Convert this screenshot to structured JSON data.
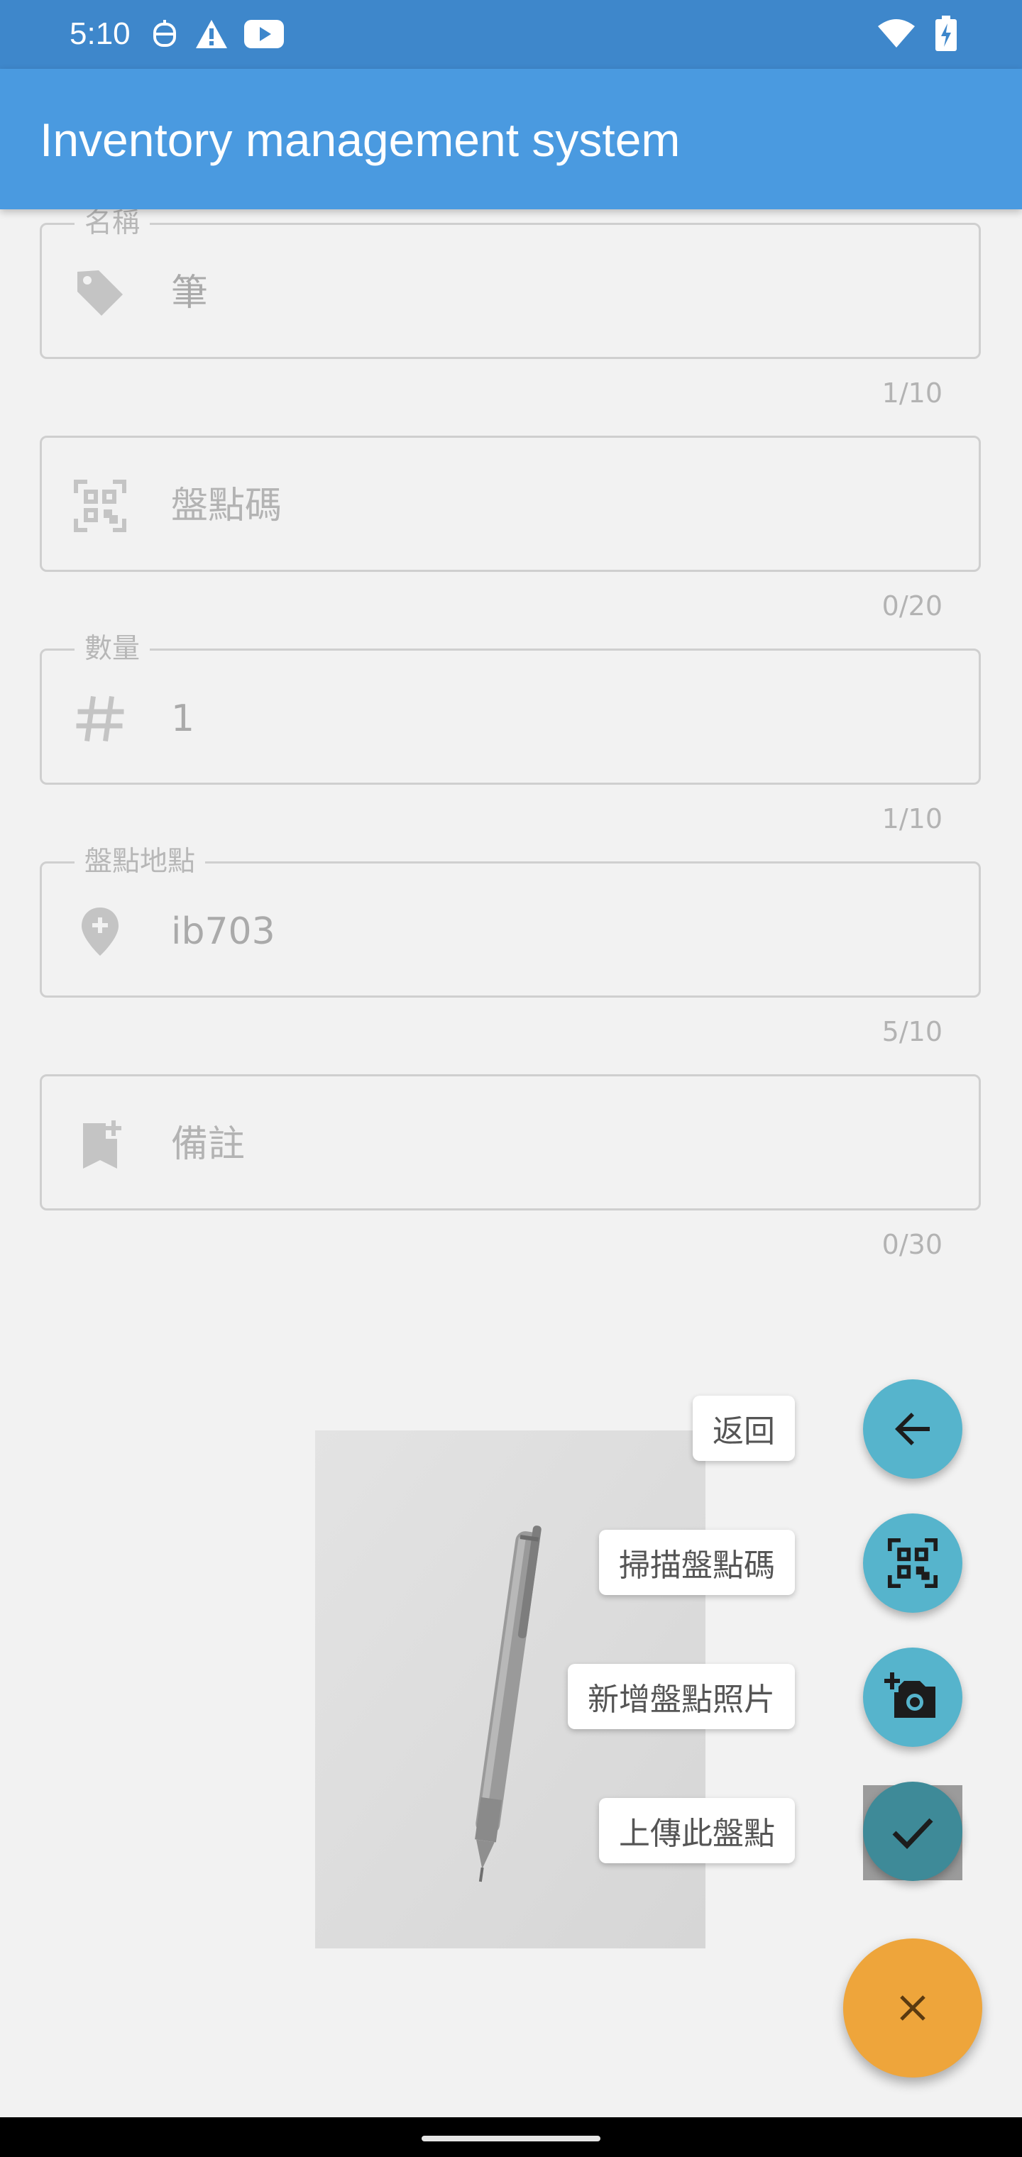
{
  "status_bar": {
    "time": "5:10",
    "left_icons": [
      "robot-icon",
      "warning-icon",
      "youtube-icon"
    ],
    "right_icons": [
      "wifi-icon",
      "battery-charging-icon"
    ]
  },
  "app_bar": {
    "title": "Inventory management system"
  },
  "form": {
    "name": {
      "label": "名稱",
      "value": "筆",
      "counter": "1/10",
      "icon": "tag-icon"
    },
    "code": {
      "placeholder": "盤點碼",
      "counter": "0/20",
      "icon": "qr-code-icon"
    },
    "quantity": {
      "label": "數量",
      "value": "1",
      "counter": "1/10",
      "icon": "hash-icon"
    },
    "location": {
      "label": "盤點地點",
      "value": "ib703",
      "counter": "5/10",
      "icon": "location-add-icon"
    },
    "note": {
      "placeholder": "備註",
      "counter": "0/30",
      "icon": "bookmark-add-icon"
    }
  },
  "speed_dial": {
    "back_label": "返回",
    "scan_label": "掃描盤點碼",
    "photo_label": "新增盤點照片",
    "upload_label": "上傳此盤點",
    "main_icon": "close-icon"
  },
  "colors": {
    "status_bar": "#3e87cb",
    "app_bar": "#4a9ae0",
    "fab_small": "#56b4cc",
    "fab_upload": "#3e8a98",
    "fab_main": "#eea53b",
    "background": "#f2f2f2"
  }
}
